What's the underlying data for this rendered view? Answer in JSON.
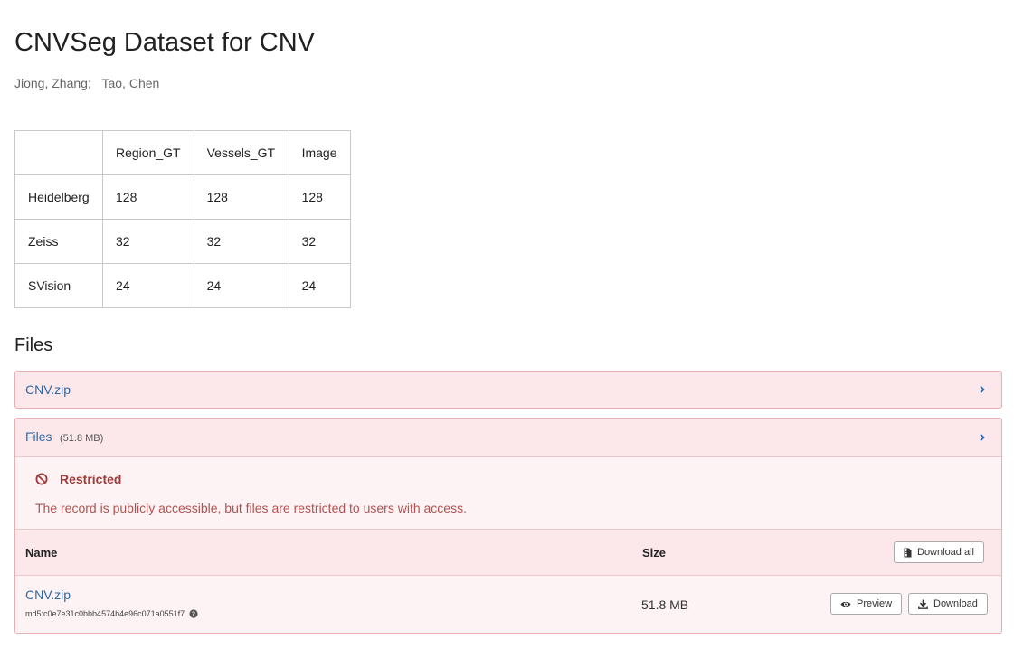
{
  "record": {
    "title": "CNVSeg Dataset for CNV",
    "authors": [
      "Jiong, Zhang;",
      "Tao, Chen"
    ]
  },
  "stats_table": {
    "header": [
      "",
      "Region_GT",
      "Vessels_GT",
      "Image"
    ],
    "rows": [
      [
        "Heidelberg",
        "128",
        "128",
        "128"
      ],
      [
        "Zeiss",
        "32",
        "32",
        "32"
      ],
      [
        "SVision",
        "24",
        "24",
        "24"
      ]
    ]
  },
  "files_section": {
    "heading": "Files",
    "preview_panel": {
      "label": "CNV.zip",
      "icon": "chevron-right-icon"
    },
    "files_panel": {
      "label": "Files",
      "size": "(51.8 MB)",
      "icon": "chevron-right-icon",
      "restricted": {
        "title": "Restricted",
        "icon": "ban-icon",
        "message": "The record is publicly accessible, but files are restricted to users with access."
      },
      "table": {
        "col_name": "Name",
        "col_size": "Size",
        "download_all_label": "Download all",
        "rows": [
          {
            "name": "CNV.zip",
            "checksum": "md5:c0e7e31c0bbb4574b4e96c071a0551f7",
            "size": "51.8 MB",
            "preview_label": "Preview",
            "download_label": "Download"
          }
        ]
      }
    }
  },
  "colors": {
    "link": "#2d69a8",
    "panel_bg": "#fce8ea",
    "panel_border": "#e7aeb3",
    "restricted_text": "#9f3a38"
  }
}
